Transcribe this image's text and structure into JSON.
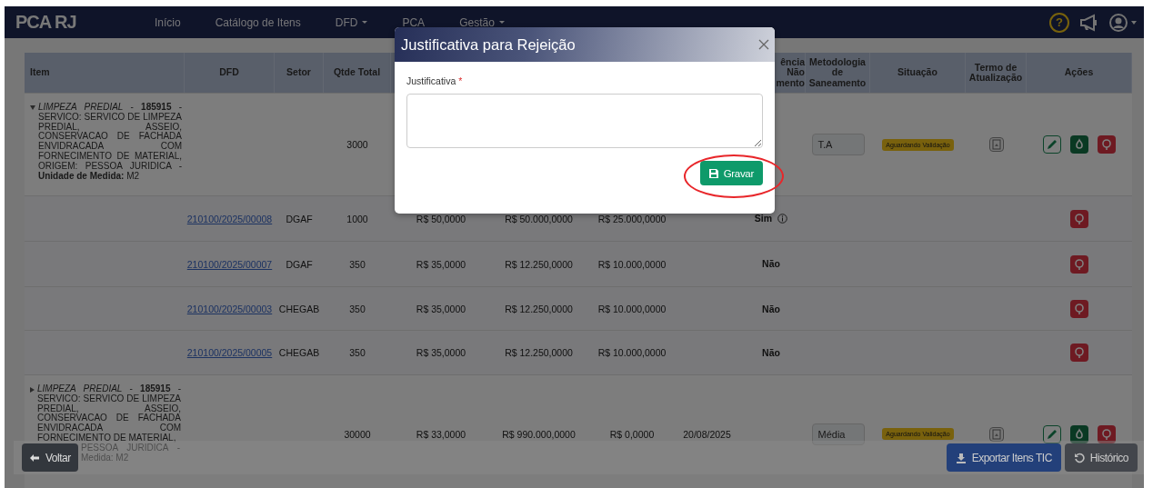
{
  "navbar": {
    "logo": "PCA RJ",
    "help": "?",
    "items": [
      {
        "label": "Início",
        "dropdown": false
      },
      {
        "label": "Catálogo de Itens",
        "dropdown": false
      },
      {
        "label": "DFD",
        "dropdown": true
      },
      {
        "label": "PCA",
        "dropdown": false
      },
      {
        "label": "Gestão",
        "dropdown": true
      }
    ]
  },
  "table": {
    "columns": [
      "Item",
      "DFD",
      "Setor",
      "Qtde Total",
      "ência\nNão\nmento",
      "Metodologia de Saneamento",
      "Situação",
      "Termo de Atualização",
      "Ações"
    ],
    "rows": [
      {
        "expanded": true,
        "item": "*LIMPEZA PREDIAL* - **185915** - SERVICO: SERVICO DE LIMPEZA PREDIAL, ASSEIO, CONSERVACAO DE FACHADA ENVIDRACADA COM FORNECIMENTO DE MATERIAL, ORIGEM: PESSOA JURIDICA - **Unidade de Medida:** M2",
        "qtde": "3000",
        "metodologia": "T.A",
        "situacao": "Aguardando Validação",
        "actions": [
          {
            "kind": "edit"
          },
          {
            "kind": "approve"
          },
          {
            "kind": "reject"
          }
        ],
        "children": [
          {
            "dfd": "210100/2025/00008",
            "setor": "DGAF",
            "qtde": "1000",
            "unit_price": "R$ 50,0000",
            "total": "R$ 50.000,0000",
            "column_7": "R$ 25.000,0000",
            "saneamento": "Sim",
            "info": true,
            "actions": [
              {
                "kind": "reject"
              }
            ]
          },
          {
            "dfd": "210100/2025/00007",
            "setor": "DGAF",
            "qtde": "350",
            "unit_price": "R$ 35,0000",
            "total": "R$ 12.250,0000",
            "column_7": "R$ 10.000,0000",
            "saneamento": "Não",
            "info": false,
            "actions": [
              {
                "kind": "reject"
              }
            ]
          },
          {
            "dfd": "210100/2025/00003",
            "setor": "CHEGAB",
            "qtde": "350",
            "unit_price": "R$ 35,0000",
            "total": "R$ 12.250,0000",
            "column_7": "R$ 10.000,0000",
            "saneamento": "Não",
            "info": false,
            "actions": [
              {
                "kind": "reject"
              }
            ]
          },
          {
            "dfd": "210100/2025/00005",
            "setor": "CHEGAB",
            "qtde": "350",
            "unit_price": "R$ 35,0000",
            "total": "R$ 12.250,0000",
            "column_7": "R$ 10.000,0000",
            "saneamento": "Não",
            "info": false,
            "actions": [
              {
                "kind": "reject"
              }
            ]
          }
        ]
      },
      {
        "expanded": false,
        "item": "*LIMPEZA PREDIAL* - **185915** - SERVICO: SERVICO DE LIMPEZA PREDIAL, ASSEIO, CONSERVACAO DE FACHADA ENVIDRACADA COM FORNECIMENTO DE MATERIAL,",
        "item_tail": [
          "PESSOA JURIDICA -",
          "Medida: M2"
        ],
        "qtde": "30000",
        "unit_price": "R$ 33,0000",
        "total": "R$ 990.000,0000",
        "column_7": "R$ 0,0000",
        "date": "20/08/2025",
        "metodologia": "Média",
        "situacao": "Aguardando Validação",
        "actions": [
          {
            "kind": "edit"
          },
          {
            "kind": "approve"
          },
          {
            "kind": "reject"
          }
        ]
      }
    ]
  },
  "footer": {
    "back": "Voltar",
    "export": "Exportar Itens TIC",
    "history": "Histórico"
  },
  "modal": {
    "title": "Justificativa para Rejeição",
    "label": "Justificativa",
    "required_mark": "*",
    "save": "Gravar"
  }
}
